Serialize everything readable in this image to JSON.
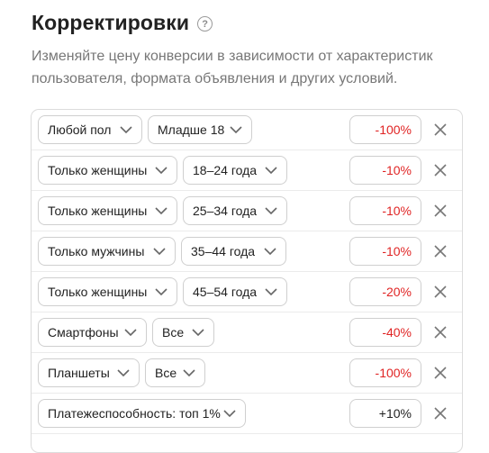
{
  "header": {
    "title": "Корректировки",
    "help_icon": "question-circle-icon",
    "help_glyph": "?"
  },
  "description": "Изменяйте цену конверсии в зависимости от характеристик пользователя, формата объявления и других условий.",
  "colors": {
    "negative": "#e02424",
    "positive": "#222222",
    "border": "#cfcfcf"
  },
  "rows": [
    {
      "first": "Любой пол",
      "second": "Младше 18",
      "value": "-100%"
    },
    {
      "first": "Только женщины",
      "second": "18–24 года",
      "value": "-10%"
    },
    {
      "first": "Только женщины",
      "second": "25–34 года",
      "value": "-10%"
    },
    {
      "first": "Только мужчины",
      "second": "35–44 года",
      "value": "-10%"
    },
    {
      "first": "Только женщины",
      "second": "45–54 года",
      "value": "-20%"
    },
    {
      "first": "Смартфоны",
      "second": "Все",
      "value": "-40%"
    },
    {
      "first": "Планшеты",
      "second": "Все",
      "value": "-100%"
    },
    {
      "first": "Платежеспособность: топ 1%",
      "second": null,
      "value": "+10%"
    }
  ]
}
